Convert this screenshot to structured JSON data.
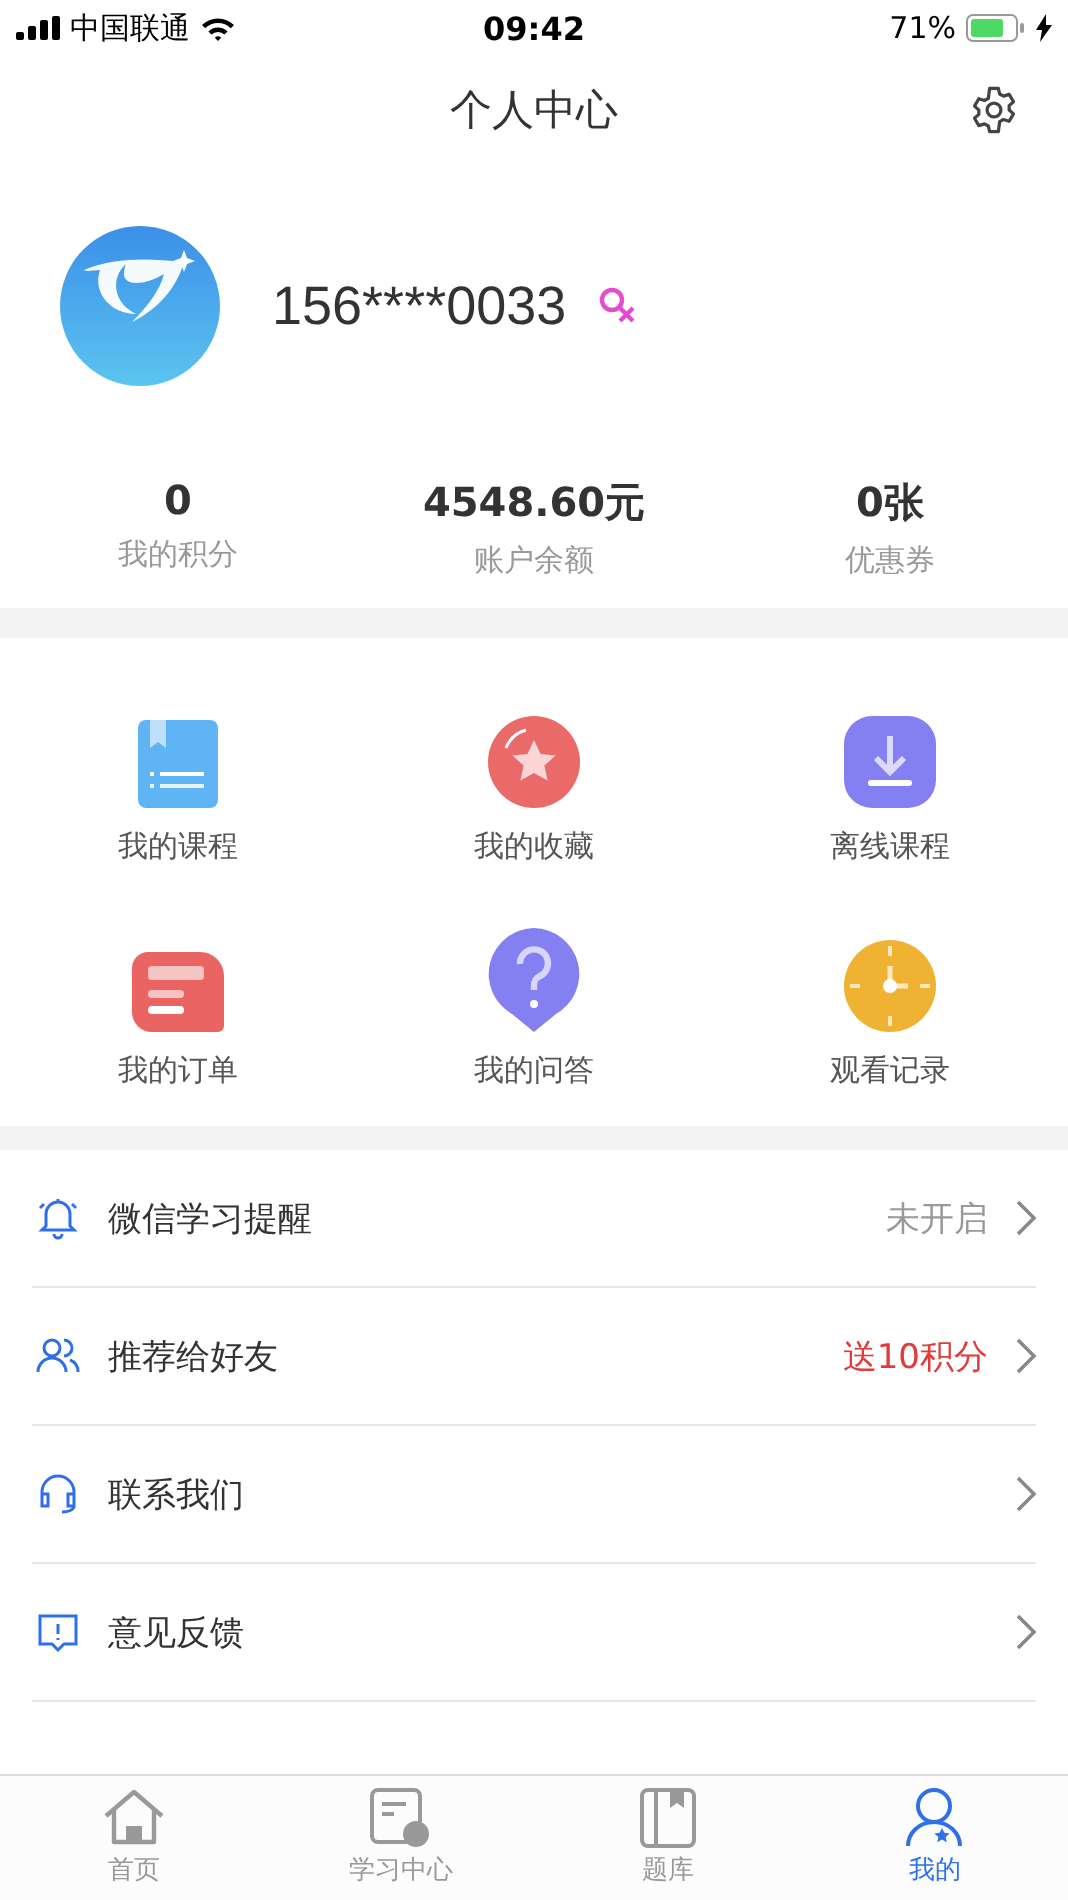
{
  "status_bar": {
    "carrier": "中国联通",
    "time": "09:42",
    "battery": "71%"
  },
  "nav": {
    "title": "个人中心"
  },
  "profile": {
    "phone": "156****0033",
    "female": true
  },
  "stats": [
    {
      "value": "0",
      "label": "我的积分"
    },
    {
      "value": "4548.60元",
      "label": "账户余额"
    },
    {
      "value": "0张",
      "label": "优惠券"
    }
  ],
  "shortcuts": [
    {
      "kind": "course",
      "label": "我的课程"
    },
    {
      "kind": "favorite",
      "label": "我的收藏"
    },
    {
      "kind": "download",
      "label": "离线课程"
    },
    {
      "kind": "order",
      "label": "我的订单"
    },
    {
      "kind": "question",
      "label": "我的问答"
    },
    {
      "kind": "history",
      "label": "观看记录"
    }
  ],
  "menu": [
    {
      "kind": "bell",
      "label": "微信学习提醒",
      "value": "未开启",
      "highlight": false
    },
    {
      "kind": "friends",
      "label": "推荐给好友",
      "value": "送10积分",
      "highlight": true
    },
    {
      "kind": "headset",
      "label": "联系我们"
    },
    {
      "kind": "feedback",
      "label": "意见反馈"
    }
  ],
  "tabs": [
    {
      "kind": "home",
      "label": "首页",
      "selected": false
    },
    {
      "kind": "study",
      "label": "学习中心",
      "selected": false
    },
    {
      "kind": "bank",
      "label": "题库",
      "selected": false
    },
    {
      "kind": "me",
      "label": "我的",
      "selected": true
    }
  ]
}
